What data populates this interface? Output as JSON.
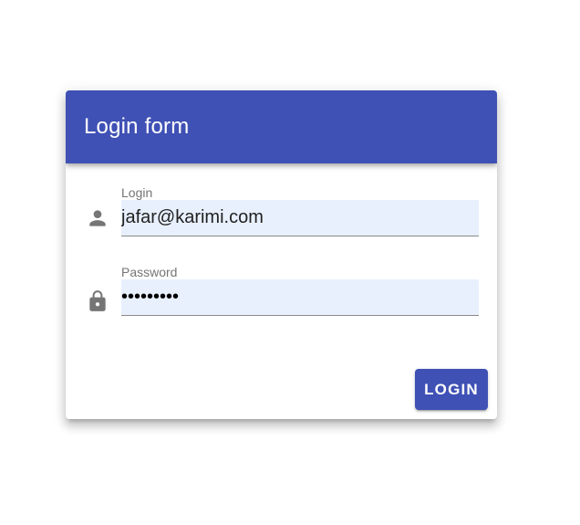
{
  "form": {
    "title": "Login form",
    "login": {
      "label": "Login",
      "value": "jafar@karimi.com",
      "icon": "person-icon"
    },
    "password": {
      "label": "Password",
      "value": "123456789",
      "icon": "lock-icon"
    },
    "submit_label": "LOGIN"
  },
  "colors": {
    "primary": "#3f51b5",
    "autofill_background": "#e8f0fe",
    "icon": "#757575"
  }
}
